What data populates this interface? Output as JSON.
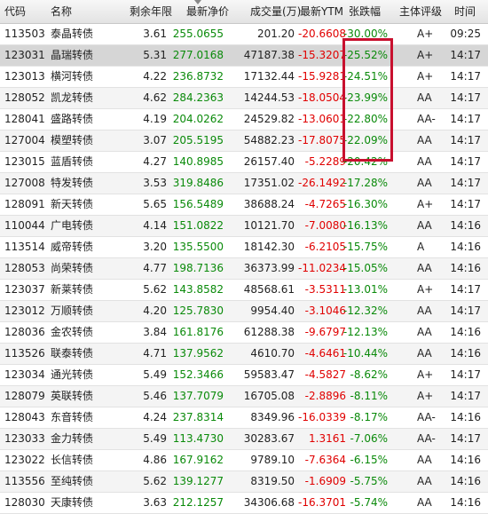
{
  "headers": [
    "代码",
    "名称",
    "剩余年限",
    "最新净价",
    "成交量(万)",
    "最新YTM",
    "张跌幅",
    "主体评级",
    "时间"
  ],
  "rows": [
    [
      "113503",
      "泰晶转债",
      "3.61",
      "255.0655",
      "201.20",
      "-20.6608",
      "-30.00%",
      "A+",
      "09:25"
    ],
    [
      "123031",
      "晶瑞转债",
      "5.31",
      "277.0168",
      "47187.38",
      "-15.3207",
      "-25.52%",
      "A+",
      "14:17"
    ],
    [
      "123013",
      "横河转债",
      "4.22",
      "236.8732",
      "17132.44",
      "-15.9281",
      "-24.51%",
      "A+",
      "14:17"
    ],
    [
      "128052",
      "凯龙转债",
      "4.62",
      "284.2363",
      "14244.53",
      "-18.0504",
      "-23.99%",
      "AA",
      "14:17"
    ],
    [
      "128041",
      "盛路转债",
      "4.19",
      "204.0262",
      "24529.82",
      "-13.0601",
      "-22.80%",
      "AA-",
      "14:17"
    ],
    [
      "127004",
      "模塑转债",
      "3.07",
      "205.5195",
      "54882.23",
      "-17.8075",
      "-22.09%",
      "AA",
      "14:17"
    ],
    [
      "123015",
      "蓝盾转债",
      "4.27",
      "140.8985",
      "26157.40",
      "-5.2289",
      "-20.42%",
      "AA",
      "14:17"
    ],
    [
      "127008",
      "特发转债",
      "3.53",
      "319.8486",
      "17351.02",
      "-26.1492",
      "-17.28%",
      "AA",
      "14:17"
    ],
    [
      "128091",
      "新天转债",
      "5.65",
      "156.5489",
      "38688.24",
      "-4.7265",
      "-16.30%",
      "A+",
      "14:17"
    ],
    [
      "110044",
      "广电转债",
      "4.14",
      "151.0822",
      "10121.70",
      "-7.0080",
      "-16.13%",
      "AA",
      "14:16"
    ],
    [
      "113514",
      "威帝转债",
      "3.20",
      "135.5500",
      "18142.30",
      "-6.2105",
      "-15.75%",
      "A",
      "14:16"
    ],
    [
      "128053",
      "尚荣转债",
      "4.77",
      "198.7136",
      "36373.99",
      "-11.0234",
      "-15.05%",
      "AA",
      "14:16"
    ],
    [
      "123037",
      "新莱转债",
      "5.62",
      "143.8582",
      "48568.61",
      "-3.5311",
      "-13.01%",
      "A+",
      "14:17"
    ],
    [
      "123012",
      "万顺转债",
      "4.20",
      "125.7830",
      "9954.40",
      "-3.1046",
      "-12.32%",
      "AA",
      "14:17"
    ],
    [
      "128036",
      "金农转债",
      "3.84",
      "161.8176",
      "61288.38",
      "-9.6797",
      "-12.13%",
      "AA",
      "14:16"
    ],
    [
      "113526",
      "联泰转债",
      "4.71",
      "137.9562",
      "4610.70",
      "-4.6461",
      "-10.44%",
      "AA",
      "14:16"
    ],
    [
      "123034",
      "通光转债",
      "5.49",
      "152.3466",
      "59583.47",
      "-4.5827",
      "-8.62%",
      "A+",
      "14:17"
    ],
    [
      "128079",
      "英联转债",
      "5.46",
      "137.7079",
      "16705.08",
      "-2.8896",
      "-8.11%",
      "A+",
      "14:17"
    ],
    [
      "128043",
      "东音转债",
      "4.24",
      "237.8314",
      "8349.96",
      "-16.0339",
      "-8.17%",
      "AA-",
      "14:16"
    ],
    [
      "123033",
      "金力转债",
      "5.49",
      "113.4730",
      "30283.67",
      "1.3161",
      "-7.06%",
      "AA-",
      "14:17"
    ],
    [
      "123022",
      "长信转债",
      "4.86",
      "167.9162",
      "9789.10",
      "-7.6364",
      "-6.15%",
      "AA",
      "14:16"
    ],
    [
      "113556",
      "至纯转债",
      "5.62",
      "139.1277",
      "8319.50",
      "-1.6909",
      "-5.75%",
      "AA",
      "14:16"
    ],
    [
      "128030",
      "天康转债",
      "3.63",
      "212.1257",
      "34306.68",
      "-16.3701",
      "-5.74%",
      "AA",
      "14:16"
    ]
  ],
  "colors": {
    "loss": "#e00000",
    "price": "#0a8a0a",
    "highlight": "#c8102e",
    "header_bg": "#e8e8e8",
    "selected_row": "#d6d6d6"
  }
}
